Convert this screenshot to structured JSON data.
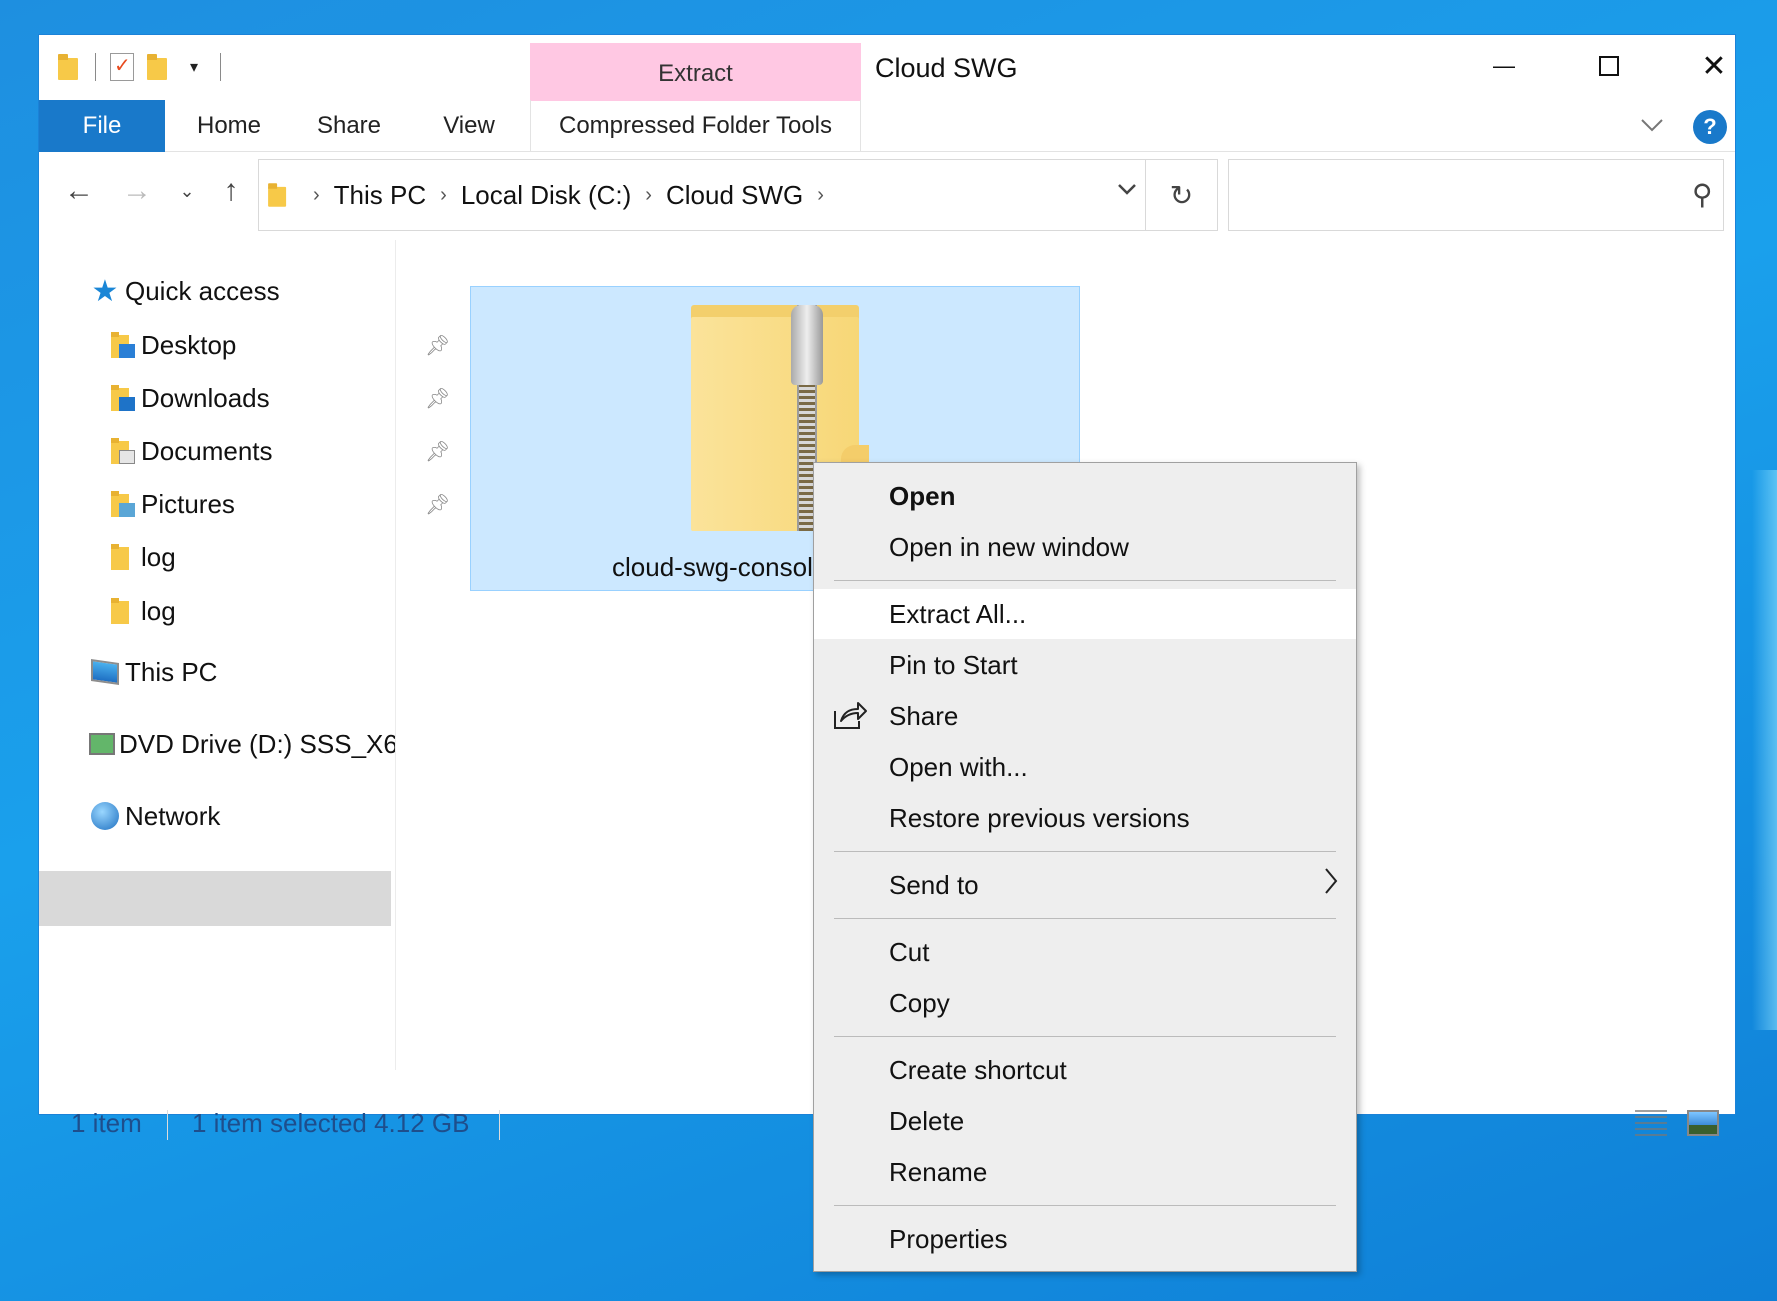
{
  "window": {
    "title": "Cloud SWG",
    "context_tab_group": "Extract",
    "controls": {
      "minimize": "—",
      "close": "✕"
    }
  },
  "ribbon": {
    "tabs": [
      "File",
      "Home",
      "Share",
      "View",
      "Compressed Folder Tools"
    ],
    "active_tab": "File",
    "help": "?"
  },
  "address_bar": {
    "breadcrumbs": [
      "This PC",
      "Local Disk (C:)",
      "Cloud SWG"
    ],
    "search_placeholder": ""
  },
  "nav_pane": {
    "quick_access": "Quick access",
    "items": [
      {
        "label": "Desktop",
        "pinned": true
      },
      {
        "label": "Downloads",
        "pinned": true
      },
      {
        "label": "Documents",
        "pinned": true
      },
      {
        "label": "Pictures",
        "pinned": true
      },
      {
        "label": "log",
        "pinned": false
      },
      {
        "label": "log",
        "pinned": false
      }
    ],
    "this_pc": "This PC",
    "dvd_drive": "DVD Drive (D:) SSS_X6",
    "network": "Network"
  },
  "content": {
    "file_name": "cloud-swg-console-v",
    "selected": true
  },
  "status_bar": {
    "item_count": "1 item",
    "selection": "1 item selected  4.12 GB"
  },
  "context_menu": {
    "open": "Open",
    "open_new_window": "Open in new window",
    "extract_all": "Extract All...",
    "pin_to_start": "Pin to Start",
    "share": "Share",
    "open_with": "Open with...",
    "restore_previous": "Restore previous versions",
    "send_to": "Send to",
    "cut": "Cut",
    "copy": "Copy",
    "create_shortcut": "Create shortcut",
    "delete": "Delete",
    "rename": "Rename",
    "properties": "Properties",
    "highlighted": "Extract All..."
  }
}
